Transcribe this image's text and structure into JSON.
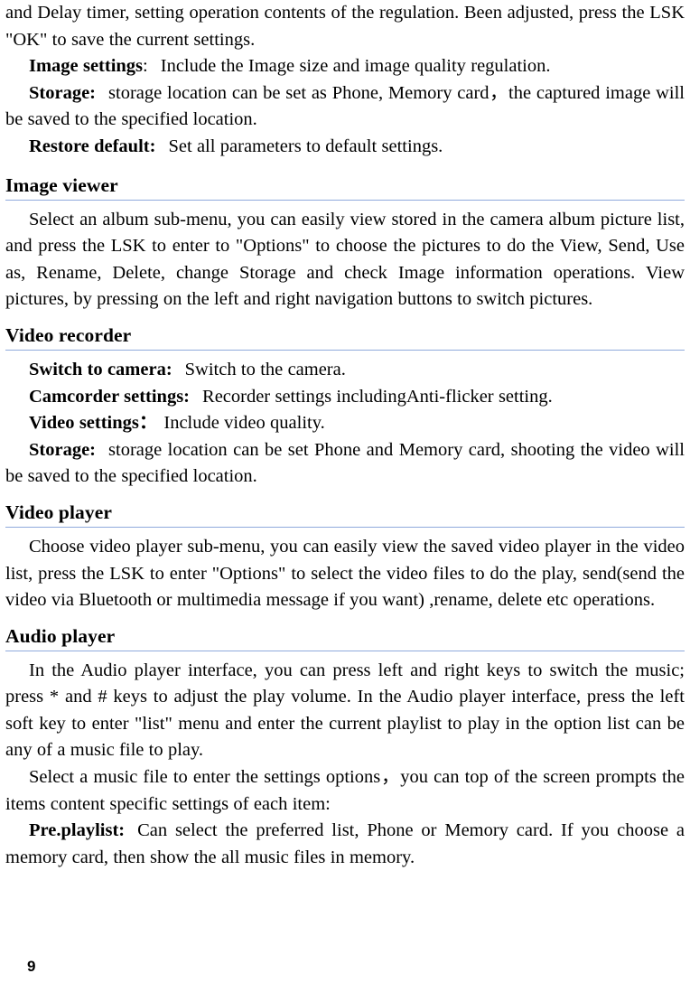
{
  "document": {
    "page_number": "9",
    "rule_color": "#8faadc",
    "text_color": "#000000",
    "background_color": "#ffffff"
  },
  "top_paragraph": {
    "text": "and Delay timer, setting operation contents of the regulation. Been adjusted, press the LSK \"OK\" to save the current settings."
  },
  "camera_items": [
    {
      "label": "Image settings",
      "separator": ":",
      "text": "Include the Image size and image quality regulation."
    },
    {
      "label": "Storage:",
      "separator": "",
      "text": "storage location can be set as Phone, Memory card，the captured image will be saved to the specified location."
    },
    {
      "label": "Restore default:",
      "separator": "",
      "text": "Set all parameters to default settings."
    }
  ],
  "sections": [
    {
      "id": "image-viewer",
      "heading": "Image viewer",
      "paragraphs": [
        "Select an album sub-menu, you can easily view stored in the camera album picture list, and press the LSK to enter to \"Options\" to choose the pictures to do the View, Send, Use as, Rename, Delete, change Storage and check Image information operations. View pictures, by pressing on the left and right navigation buttons to switch pictures."
      ],
      "items": []
    },
    {
      "id": "video-recorder",
      "heading": "Video recorder",
      "paragraphs": [],
      "items": [
        {
          "label": "Switch to camera:",
          "separator": "",
          "text": "Switch to the camera."
        },
        {
          "label": "Camcorder settings:",
          "separator": "",
          "text": "Recorder settings includingAnti-flicker setting."
        },
        {
          "label": "Video settings：",
          "separator": "",
          "text": "Include video quality."
        },
        {
          "label": "Storage:",
          "separator": "",
          "text": "storage location can be set Phone and Memory card, shooting the video will be saved to the specified location."
        }
      ]
    },
    {
      "id": "video-player",
      "heading": "Video player",
      "paragraphs": [
        "Choose video player sub-menu, you can easily view the saved video player in the video list, press the LSK to enter \"Options\" to select the video files to do the play, send(send the video via Bluetooth or multimedia message if you want) ,rename, delete etc operations."
      ],
      "items": []
    },
    {
      "id": "audio-player",
      "heading": "Audio player",
      "paragraphs": [
        "In the Audio player interface, you can press left and right keys to switch the music; press * and # keys to adjust the play volume. In the Audio player interface, press the left soft key to enter \"list\" menu and enter the current playlist to play in the option list can be any of a music file to play.",
        "Select a music file to enter the settings options，you can top of the screen prompts the items content specific settings of each item:"
      ],
      "items": [
        {
          "label": "Pre.playlist:",
          "separator": "",
          "text": "Can select the preferred list, Phone or Memory card. If you choose a memory card, then show the all music files in memory."
        }
      ]
    }
  ]
}
